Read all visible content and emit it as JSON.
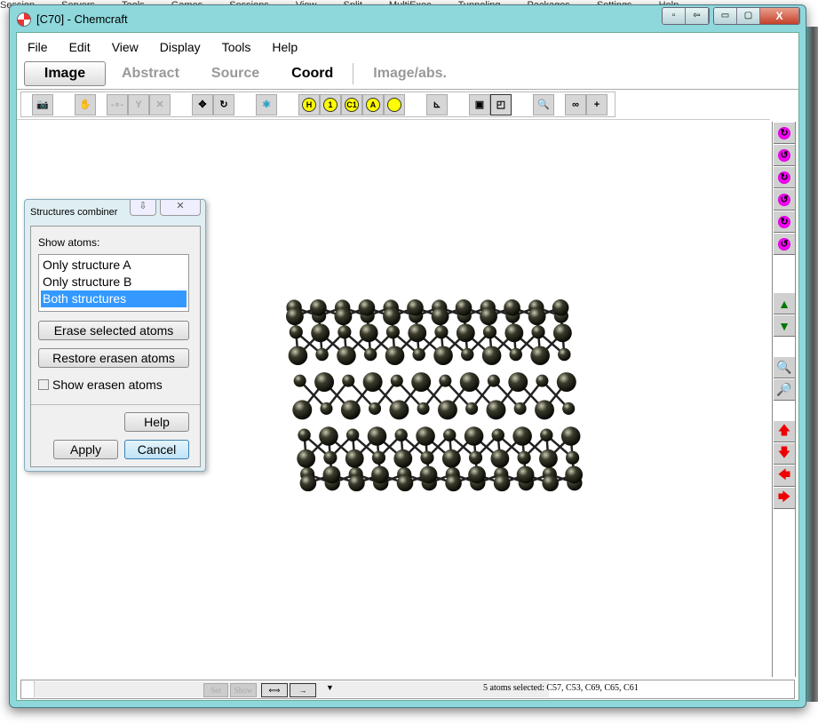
{
  "background_menu": [
    "Session",
    "Servers",
    "Tools",
    "Games",
    "Sessions",
    "View",
    "Split",
    "MultiExec",
    "Tunneling",
    "Packages",
    "Settings",
    "Help"
  ],
  "window": {
    "title": "[C70] - Chemcraft"
  },
  "menu": [
    "File",
    "Edit",
    "View",
    "Display",
    "Tools",
    "Help"
  ],
  "tabs": [
    {
      "label": "Image",
      "state": "active"
    },
    {
      "label": "Abstract",
      "state": "disabled"
    },
    {
      "label": "Source",
      "state": "disabled"
    },
    {
      "label": "Coord",
      "state": "normal"
    },
    {
      "label": "Image/abs.",
      "state": "disabled"
    }
  ],
  "toolbar": {
    "label_buttons": [
      "H",
      "1",
      "C1",
      "A",
      ""
    ]
  },
  "dialog": {
    "title": "Structures combiner",
    "show_atoms_label": "Show atoms:",
    "options": [
      "Only structure A",
      "Only structure B",
      "Both structures"
    ],
    "selected_option": "Both structures",
    "erase_button": "Erase selected atoms",
    "restore_button": "Restore erasen atoms",
    "show_erasen_label": "Show erasen atoms",
    "show_erasen_checked": false,
    "help_button": "Help",
    "apply_button": "Apply",
    "cancel_button": "Cancel"
  },
  "status": {
    "set_button": "Set",
    "show_button": "Show",
    "text": "5 atoms selected: C57, C53, C69, C65, C61"
  },
  "colors": {
    "accent": "#3399ff",
    "frame": "#8ed8dc",
    "atom": "#3a3a2c"
  }
}
